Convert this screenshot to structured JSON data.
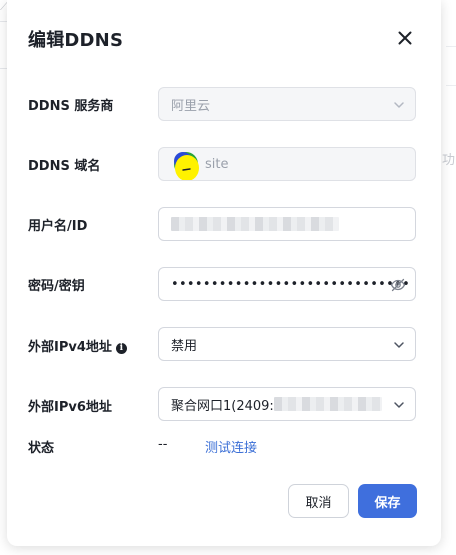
{
  "background": {
    "right_text": "功"
  },
  "dialog": {
    "title": "编辑DDNS",
    "close_icon": "close-icon"
  },
  "fields": {
    "provider": {
      "label": "DDNS 服务商",
      "value": "阿里云"
    },
    "domain": {
      "label": "DDNS 域名",
      "value": "site"
    },
    "username": {
      "label": "用户名/ID"
    },
    "password": {
      "label": "密码/密钥",
      "value": "••••••••••••••••••••••••••••••"
    },
    "ipv4": {
      "label": "外部IPv4地址",
      "value": "禁用"
    },
    "ipv6": {
      "label": "外部IPv6地址",
      "value": "聚合网口1(2409:"
    },
    "status": {
      "label": "状态",
      "value": "--",
      "test_link": "测试连接"
    }
  },
  "buttons": {
    "cancel": "取消",
    "save": "保存"
  },
  "colors": {
    "primary": "#3f6fdd",
    "link": "#3b6fd6"
  }
}
